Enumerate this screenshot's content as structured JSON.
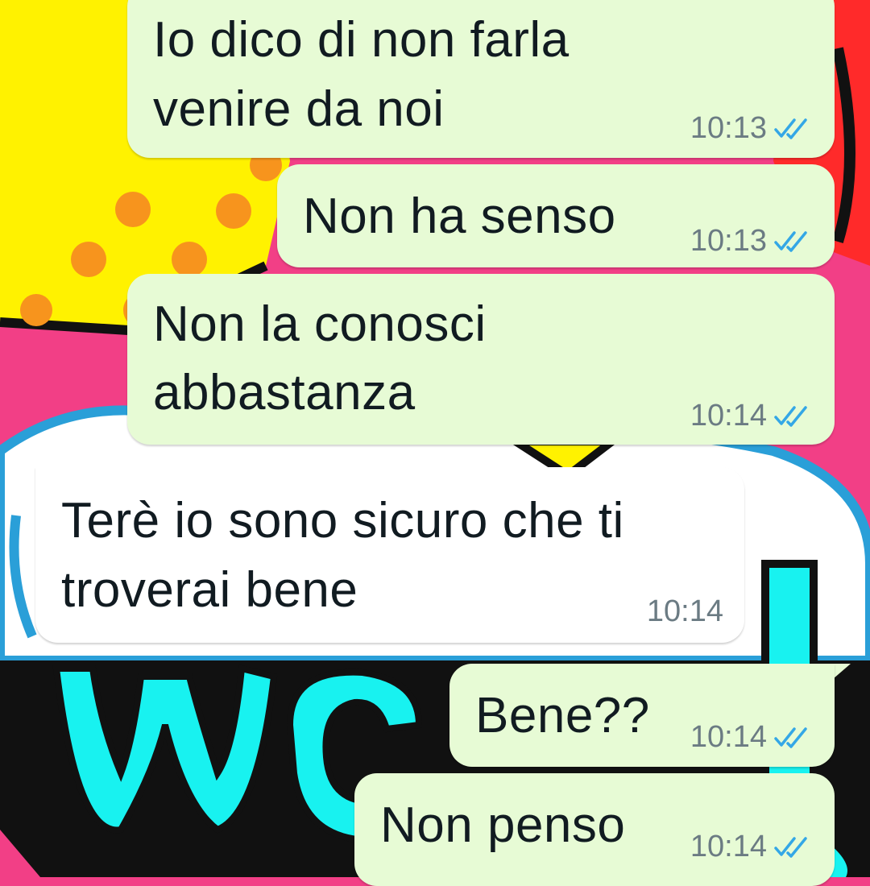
{
  "chat": {
    "messages": [
      {
        "direction": "outgoing",
        "lines": [
          "Io dico di non farla",
          "venire da noi"
        ],
        "time": "10:13",
        "status": "read",
        "status_icon": "double-check-icon"
      },
      {
        "direction": "outgoing",
        "lines": [
          "Non ha senso"
        ],
        "time": "10:13",
        "status": "read",
        "status_icon": "double-check-icon"
      },
      {
        "direction": "outgoing",
        "lines": [
          "Non la conosci",
          "abbastanza"
        ],
        "time": "10:14",
        "status": "read",
        "status_icon": "double-check-icon"
      },
      {
        "direction": "incoming",
        "lines": [
          "Terè io sono sicuro che ti",
          "troverai bene"
        ],
        "time": "10:14"
      },
      {
        "direction": "outgoing",
        "lines": [
          "Bene??"
        ],
        "time": "10:14",
        "status": "read",
        "status_icon": "double-check-icon"
      },
      {
        "direction": "outgoing",
        "lines": [
          "Non penso"
        ],
        "time": "10:14",
        "status": "read",
        "status_icon": "double-check-icon"
      }
    ]
  },
  "colors": {
    "outgoing_bubble": "#e7fbd5",
    "incoming_bubble": "#ffffff",
    "read_ticks": "#34a7e6",
    "timestamp": "#6b7b83",
    "wallpaper_pink": "#f23f86",
    "wallpaper_yellow": "#fff200",
    "wallpaper_cyan": "#18f2f0",
    "wallpaper_red": "#ff2a2a"
  }
}
